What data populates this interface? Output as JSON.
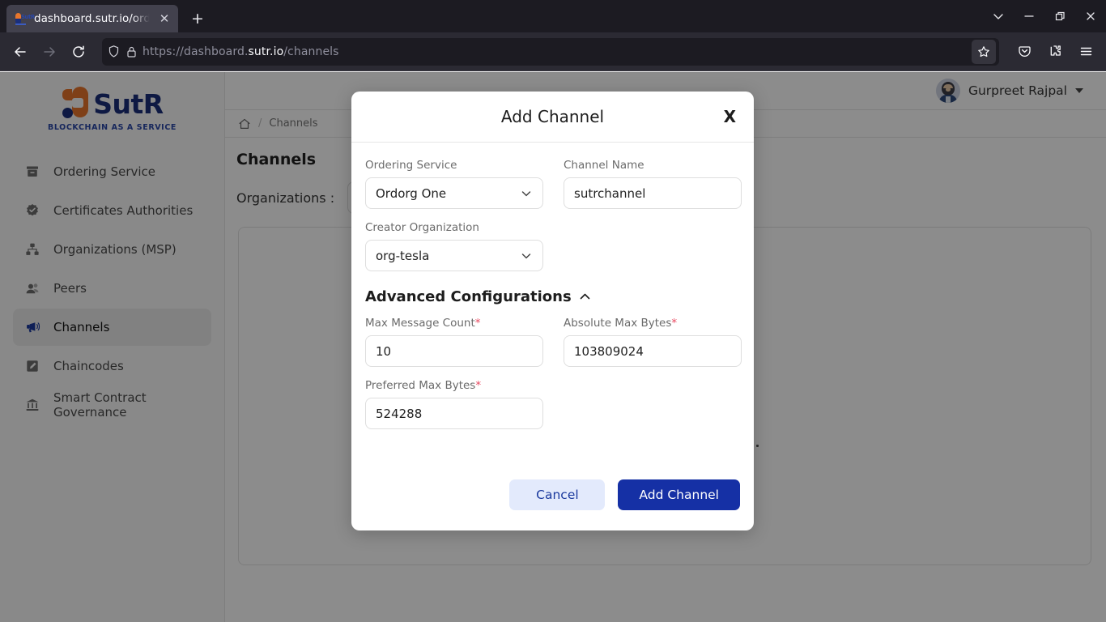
{
  "browser": {
    "tab": {
      "title": "dashboard.sutr.io/orderin",
      "favicon": "sutr-favicon",
      "close_label": "✕"
    },
    "new_tab_label": "+",
    "window_controls": {
      "list_tabs": "list-all-tabs",
      "minimize": "minimize",
      "maximize": "maximize",
      "close": "close"
    },
    "toolbar": {
      "back": "back-icon",
      "forward": "forward-icon",
      "reload": "reload-icon",
      "shield": "tracking-protection-icon",
      "lock": "padlock-icon",
      "url_prefix": "https://dashboard.",
      "url_domain": "sutr.io",
      "url_suffix": "/channels",
      "bookmark": "star-icon",
      "save_to_pocket": "pocket-icon",
      "extensions": "extensions-icon",
      "app_menu": "hamburger-menu-icon"
    }
  },
  "sidebar": {
    "logo_text": "SutR",
    "logo_tagline": "BLOCKCHAIN AS A SERVICE",
    "items": [
      {
        "label": "Ordering Service",
        "icon": "archive-icon",
        "active": false
      },
      {
        "label": "Certificates Authorities",
        "icon": "badge-check-icon",
        "active": false
      },
      {
        "label": "Organizations (MSP)",
        "icon": "sitemap-icon",
        "active": false
      },
      {
        "label": "Peers",
        "icon": "users-icon",
        "active": false
      },
      {
        "label": "Channels",
        "icon": "megaphone-icon",
        "active": true
      },
      {
        "label": "Chaincodes",
        "icon": "note-icon",
        "active": false
      },
      {
        "label": "Smart Contract Governance",
        "icon": "bank-icon",
        "active": false
      }
    ]
  },
  "header": {
    "user_name": "Gurpreet Rajpal",
    "avatar": "user-avatar",
    "dropdown": "chevron-down-icon"
  },
  "breadcrumb": {
    "home_icon": "home-icon",
    "separator": "/",
    "current": "Channels"
  },
  "main": {
    "page_title": "Channels",
    "organizations_label": "Organizations :",
    "organizations_value": ""
  },
  "modal": {
    "title": "Add Channel",
    "close_label": "X",
    "fields": {
      "ordering_service": {
        "label": "Ordering Service",
        "value": "Ordorg One",
        "chevron": "chevron-down-icon"
      },
      "channel_name": {
        "label": "Channel Name",
        "value": "sutrchannel",
        "placeholder": "Channel Name"
      },
      "creator_organization": {
        "label": "Creator Organization",
        "value": "org-tesla",
        "chevron": "chevron-down-icon"
      },
      "max_message_count": {
        "label": "Max Message Count",
        "required": "*",
        "value": "10"
      },
      "absolute_max_bytes": {
        "label": "Absolute Max Bytes",
        "required": "*",
        "value": "103809024"
      },
      "preferred_max_bytes": {
        "label": "Preferred Max Bytes",
        "required": "*",
        "value": "524288"
      }
    },
    "advanced": {
      "title": "Advanced Configurations",
      "toggle_icon": "chevron-up-icon"
    },
    "buttons": {
      "cancel": "Cancel",
      "submit": "Add Channel"
    }
  },
  "colors": {
    "brand_blue": "#1b2f7a",
    "brand_orange": "#e8762c",
    "primary_button": "#1530a5",
    "cancel_button_bg": "#e3eafc",
    "required_red": "#e8475f"
  }
}
